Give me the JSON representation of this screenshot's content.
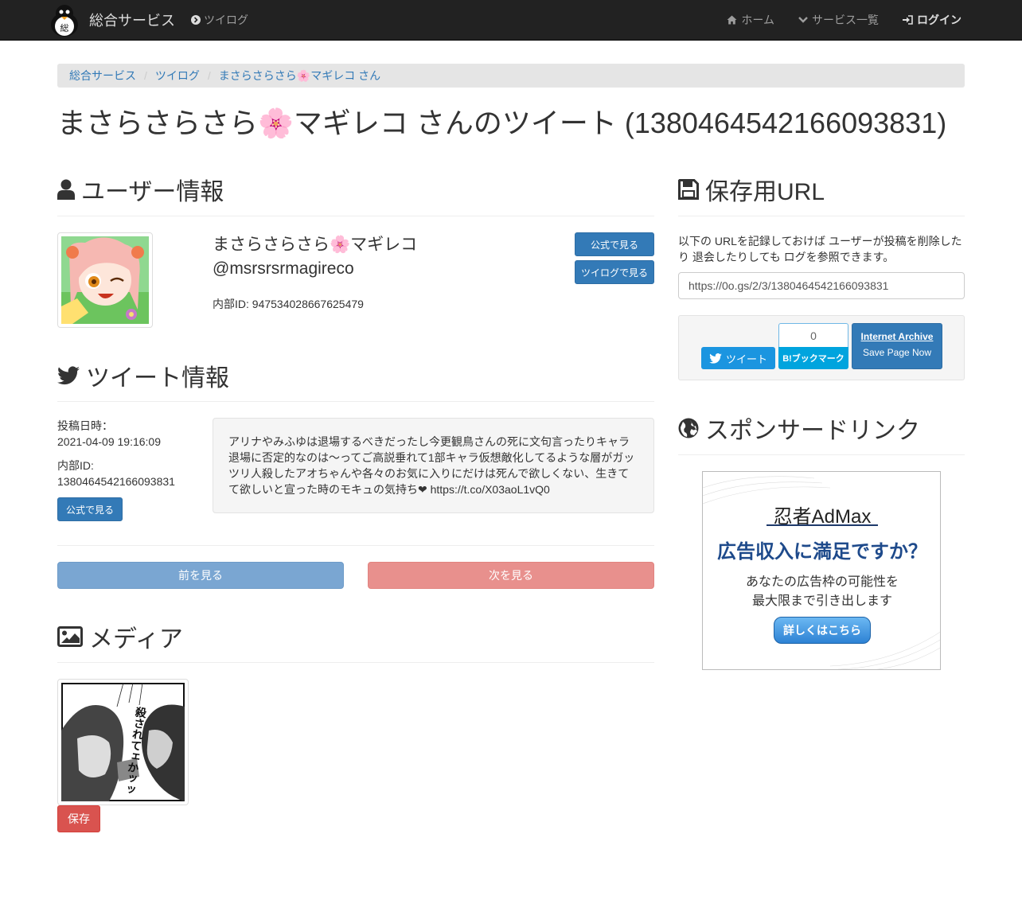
{
  "navbar": {
    "brand": "総合サービス",
    "left_link": "ツイログ",
    "home": "ホーム",
    "services": "サービス一覧",
    "login": "ログイン"
  },
  "breadcrumb": [
    "総合サービス",
    "ツイログ",
    "まさらさらさら🌸マギレコ さん"
  ],
  "page_title": "まさらさらさら🌸マギレコ さんのツイート (1380464542166093831)",
  "user_section": {
    "heading": "ユーザー情報",
    "display_name": "まさらさらさら🌸マギレコ",
    "screen_name": "@msrsrsrmagireco",
    "internal_id": "内部ID: 947534028667625479",
    "btn_official": "公式で見る",
    "btn_twilog": "ツイログで見る"
  },
  "tweet_section": {
    "heading": "ツイート情報",
    "posted_label": "投稿日時：",
    "posted_value": "2021-04-09 19:16:09",
    "id_label": "内部ID:",
    "id_value": "1380464542166093831",
    "btn_official": "公式で見る",
    "text": "アリナやみふゆは退場するべきだったし今更観鳥さんの死に文句言ったりキャラ退場に否定的なのは〜ってご高説垂れて1部キャラ仮想敵化してるような層がガッツリ人殺したアオちゃんや各々のお気に入りにだけは死んで欲しくない、生きてて欲しいと宣った時のモキュの気持ち❤ https://t.co/X03aoL1vQ0"
  },
  "pager": {
    "prev": "前を見る",
    "next": "次を見る"
  },
  "media_section": {
    "heading": "メディア",
    "manga_text": "殺されてェかッッ",
    "save_btn": "保存"
  },
  "save_section": {
    "heading": "保存用URL",
    "description": "以下の URLを記録しておけば ユーザーが投稿を削除したり 退会したりしても ログを参照できます。",
    "url": "https://0o.gs/2/3/1380464542166093831",
    "tweet_btn": "ツイート",
    "bookmark_count": "0",
    "bookmark_label": "B!ブックマーク",
    "ia_title": "Internet Archive",
    "ia_sub": "Save Page Now"
  },
  "sponsor_section": {
    "heading": "スポンサードリンク",
    "ad_brand": "忍者AdMax",
    "ad_headline": "広告収入に満足ですか？",
    "ad_line1": "あなたの広告枠の可能性を",
    "ad_line2": "最大限まで引き出します",
    "ad_button": "詳しくはこちら"
  },
  "colors": {
    "primary": "#337ab7",
    "danger": "#d9534f",
    "pager_prev": "#7aa6d2",
    "pager_next": "#e8908d",
    "twitter": "#1b95e0",
    "hatena": "#00a4de"
  }
}
